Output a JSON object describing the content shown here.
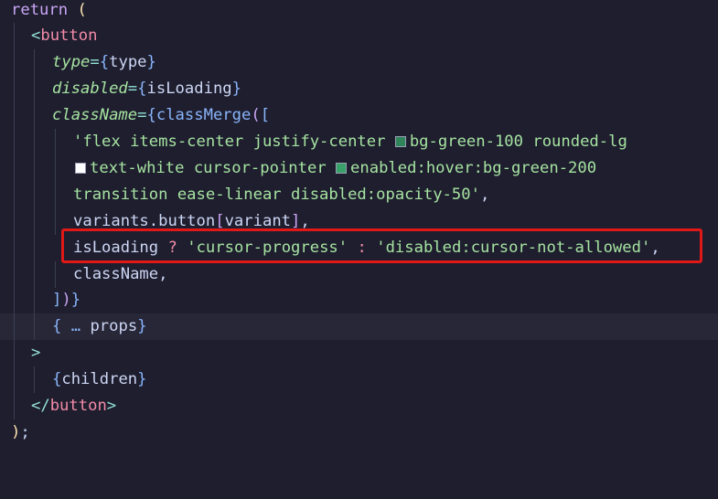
{
  "editor": {
    "kw_return": "return",
    "paren_open": "(",
    "tag_open_lt": "<",
    "tag_name": "button",
    "attr_type": "type",
    "eq": "=",
    "brace_open": "{",
    "brace_close": "}",
    "val_type": "type",
    "attr_disabled": "disabled",
    "val_isLoading": "isLoading",
    "attr_className": "className",
    "fn_classMerge": "classMerge",
    "bracket_open": "[",
    "line5_pre": "'flex items-center justify-center ",
    "line5_post": "bg-green-100 rounded-lg",
    "line6_pre": "text-white cursor-pointer ",
    "line6_post": "enabled:hover:bg-green-200",
    "line7_text": "transition ease-linear disabled:opacity-50'",
    "comma": ",",
    "line8_variants": "variants.button",
    "line8_variant": "variant",
    "bracket_close": "]",
    "line9_isLoading": "isLoading",
    "line9_q": "?",
    "line9_str1": "'cursor-progress'",
    "line9_colon": ":",
    "line9_str2": "'disabled:cursor-not-allowed'",
    "line10_className": "className",
    "line11_close": "])",
    "ellipsis": "…",
    "props": "props",
    "gt": ">",
    "children": "children",
    "tag_close_lt": "</",
    "paren_close": ")",
    "semicolon": ";",
    "swatch_colors": {
      "bg_green_100": "#2f855a",
      "text_white": "#ffffff",
      "green_200": "#38a169"
    }
  }
}
